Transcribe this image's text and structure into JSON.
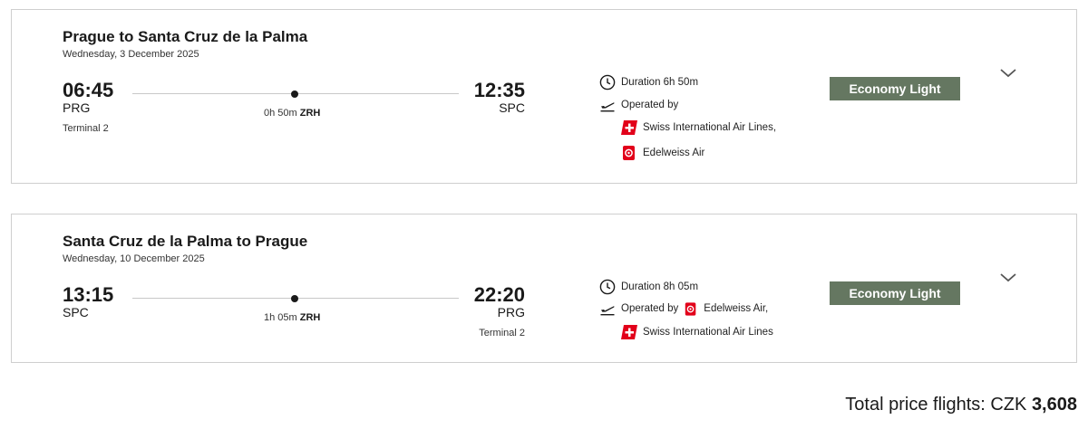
{
  "flights": [
    {
      "title": "Prague to Santa Cruz de la Palma",
      "date": "Wednesday, 3 December 2025",
      "departure_time": "06:45",
      "departure_code": "PRG",
      "departure_terminal": "Terminal 2",
      "arrival_time": "12:35",
      "arrival_code": "SPC",
      "layover_duration": "0h 50m",
      "layover_airport": "ZRH",
      "duration": "Duration 6h 50m",
      "operated_by": "Operated by",
      "airlines": [
        "Swiss International Air Lines,",
        "Edelweiss Air"
      ],
      "fare": "Economy Light"
    },
    {
      "title": "Santa Cruz de la Palma to Prague",
      "date": "Wednesday, 10 December 2025",
      "departure_time": "13:15",
      "departure_code": "SPC",
      "arrival_time": "22:20",
      "arrival_code": "PRG",
      "arrival_terminal": "Terminal 2",
      "layover_duration": "1h 05m",
      "layover_airport": "ZRH",
      "duration": "Duration 8h 05m",
      "operated_by": "Operated by",
      "airlines": [
        "Edelweiss Air,",
        "Swiss International Air Lines"
      ],
      "fare": "Economy Light"
    }
  ],
  "total": {
    "label": "Total price flights: CZK",
    "amount": "3,608"
  },
  "icons": {
    "duration": "clock-icon",
    "operated_by": "plane-takeoff-icon",
    "swiss_logo": "swiss-logo",
    "edelweiss_logo": "edelweiss-logo",
    "expand": "chevron-down-icon"
  },
  "colors": {
    "fare_badge": "#657761",
    "swiss_red": "#e2001a",
    "edelweiss_red": "#e2001a",
    "border": "#cfcfcf"
  }
}
